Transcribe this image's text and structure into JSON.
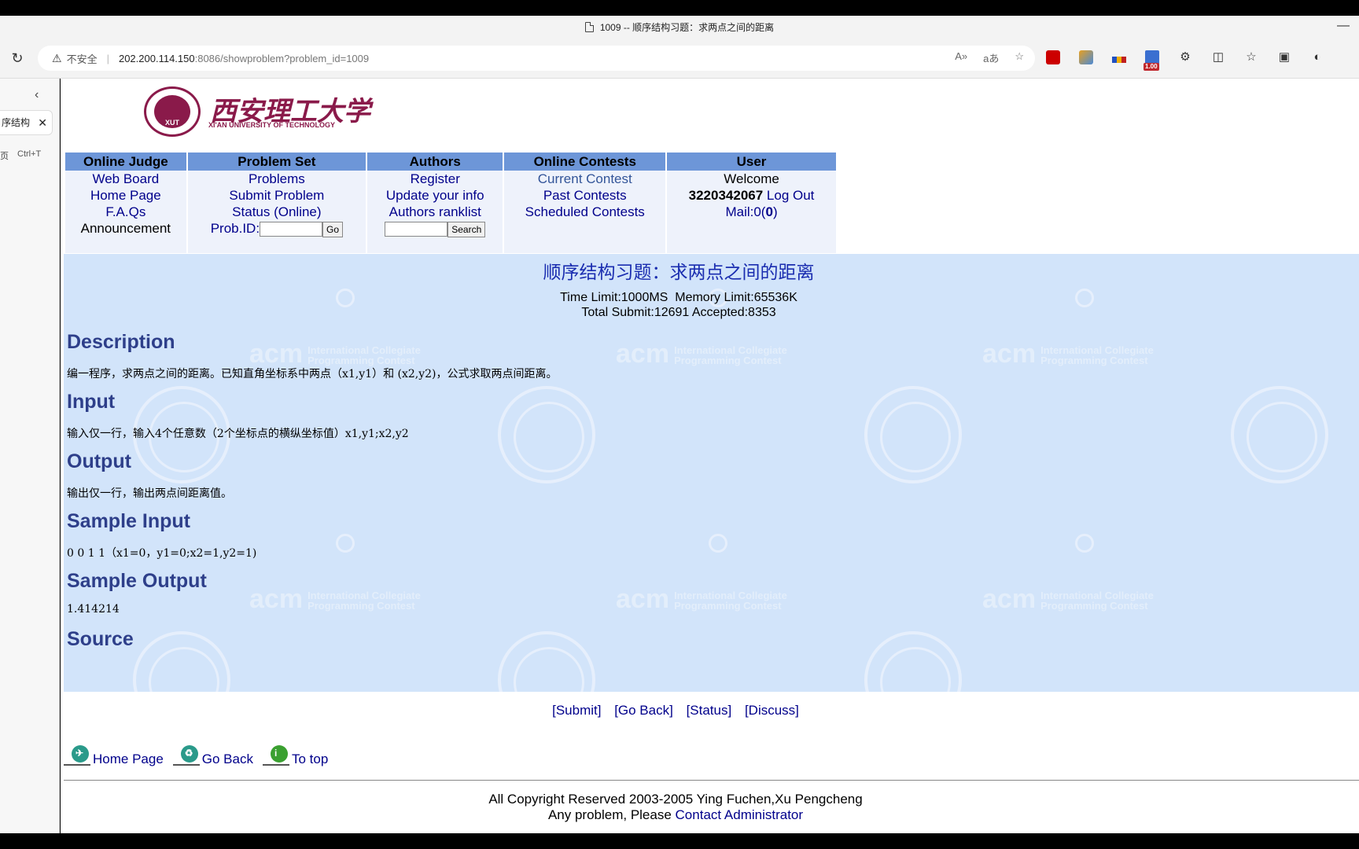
{
  "browser": {
    "tab_title": "1009 -- 顺序结构习题：求两点之间的距离",
    "not_secure": "不安全",
    "url_host": "202.200.114.150",
    "url_path": ":8086/showproblem?problem_id=1009",
    "ext_badge": "1.00",
    "side_tab_label": "序结构",
    "side_newtab_label": "页",
    "side_newtab_shortcut": "Ctrl+T"
  },
  "logo": {
    "cn_name": "西安理工大学",
    "en_name": "XI'AN UNIVERSITY OF TECHNOLOGY",
    "seal_text": "XUT"
  },
  "nav": {
    "headers": [
      "Online Judge",
      "Problem Set",
      "Authors",
      "Online Contests",
      "User"
    ],
    "oj": [
      "Web Board",
      "Home Page",
      "F.A.Qs",
      "Announcement"
    ],
    "problemset": [
      "Problems",
      "Submit Problem",
      "Status (Online)"
    ],
    "probid_label": "Prob.ID:",
    "go_label": "Go",
    "authors": [
      "Register",
      "Update your info",
      "Authors ranklist"
    ],
    "search_label": "Search",
    "contests": [
      "Current Contest",
      "Past Contests",
      "Scheduled Contests"
    ],
    "user_welcome": "Welcome",
    "user_id": "3220342067",
    "logout": "Log Out",
    "mail_prefix": "Mail:0(",
    "mail_count": "0",
    "mail_suffix": ")"
  },
  "problem": {
    "title": "顺序结构习题：求两点之间的距离",
    "limits": "Time Limit:1000MS  Memory Limit:65536K",
    "totals": "Total Submit:12691 Accepted:8353",
    "description_label": "Description",
    "description": "编一程序，求两点之间的距离。已知直角坐标系中两点（x1,y1）和 (x2,y2)，公式求取两点间距离。",
    "input_label": "Input",
    "input": "输入仅一行，输入4个任意数（2个坐标点的横纵坐标值）x1,y1;x2,y2",
    "output_label": "Output",
    "output": "输出仅一行，输出两点间距离值。",
    "sample_input_label": "Sample Input",
    "sample_input": "0 0 1 1（x1=0，y1=0;x2=1,y2=1)",
    "sample_output_label": "Sample Output",
    "sample_output": "1.414214",
    "source_label": "Source"
  },
  "watermark": {
    "acm": "acm",
    "acm_small1": "International Collegiate",
    "acm_small2": "Programming Contest"
  },
  "links": [
    "[Submit]",
    "[Go Back]",
    "[Status]",
    "[Discuss]"
  ],
  "bottom_nav": [
    "Home Page",
    "Go Back",
    "To top"
  ],
  "footer": {
    "copyright": "All Copyright Reserved 2003-2005 Ying Fuchen,Xu Pengcheng",
    "problem_prefix": "Any problem, Please ",
    "contact": "Contact Administrator"
  }
}
